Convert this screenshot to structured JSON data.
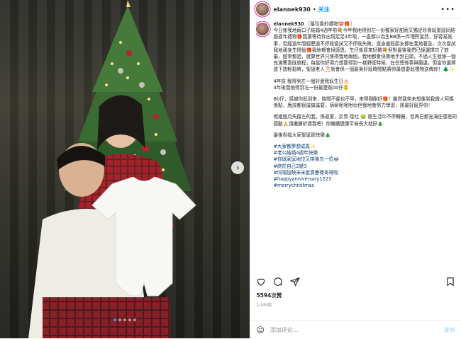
{
  "post": {
    "username": "elannek930",
    "follow_label": "关注",
    "more_icon": "ellipsis-icon"
  },
  "caption": {
    "username": "elannek930",
    "paragraphs": [
      "〖最珍貴的禮物💝🎁〗\n今日係我地兩口子結婚4週年啦💐今年我地得到左一份獨家好甜而又獨足珍貴既聖誕同結婚週年禮物🎁我猜等待你出現足足4年啦，一直都以為生BB係一件理所當然，好容易既事，但經過年間經歷過不停既嘗試又不停既失敗，逐身邊既朋友都在我地著急，次次嘗試我地親身生得個🎁我地都會很感恩，生仔係原來好難💐但對最後我們已經選擇忘了放棄，經常都話，就算世界只係得我地兩個，我地都會快樂地手到白頭，不過人生就係一個充滿驚喜既旅程，每當你好用力想要得到一樣野既時候，在往總係事與願違，但當你選擇放下放輕鬆時，聖誕老人🎅就會係一個最美好既時間點將你最想要既禮物送俾你！🌲✨",
      "4年前 我得到左一個好愛我既生日🎂\n4年後我地得到左一份最愛既bb仔👶",
      "Bb仔，感謝你既到來，時間不遲也不早，來得剛剛好🎁！雖然我仲未想像到我做人阿媽係點，應該都很識做識要，萌萌呢呢咁😍但我地會努力學習，將最好既畀你！",
      "呢幾個月失蹤左的我，係返家，反胃 噁吐 🤢 跟生活中不停轉圈，但再日都充滿住感恩同感動🙏請繼續祈禱我吧！你繼續健康平安長大就好🎄",
      "最後祝福大家聖誕節快樂🎄"
    ],
    "hashtags": [
      "#大家都夢想成真✨",
      "#老公結婚4週年快樂",
      "#你既家庭地位又排後左一位😂",
      "#終於自己2變3",
      "#同場加映米米金寶曼傑哥哥啦",
      "#happyanniversary1223",
      "#merrychristmas"
    ]
  },
  "actions": {
    "like_icon": "heart-icon",
    "comment_icon": "comment-icon",
    "share_icon": "share-icon",
    "save_icon": "bookmark-icon"
  },
  "likes_text": "5594次赞",
  "time_text": "1小时前",
  "comment_bar": {
    "placeholder": "添加评论...",
    "post_label": "发布"
  },
  "carousel": {
    "current": 1,
    "total": 5
  }
}
